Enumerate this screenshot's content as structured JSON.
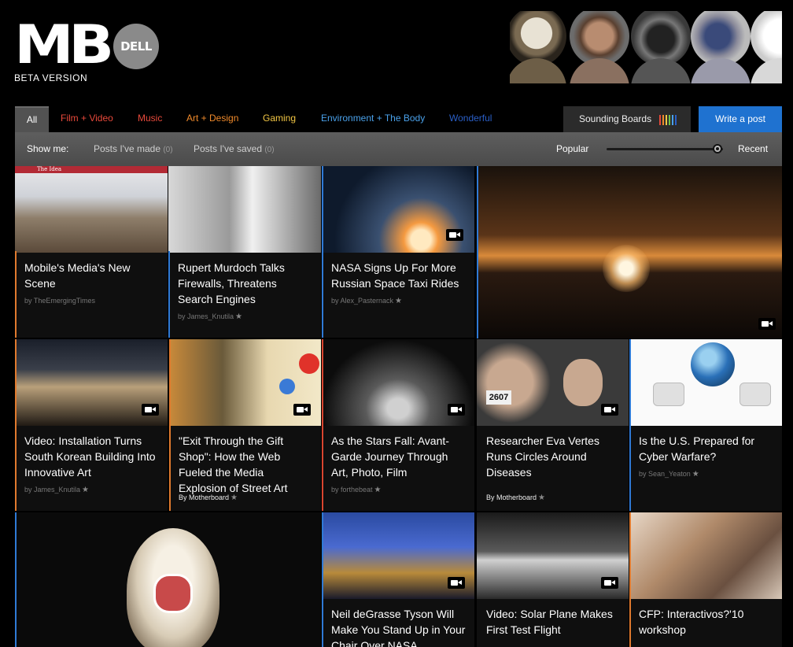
{
  "header": {
    "logo_text": "MB",
    "partner_logo": "DELL",
    "beta_label": "BETA VERSION"
  },
  "nav": {
    "tabs": [
      {
        "label": "All",
        "color": "#ffffff"
      },
      {
        "label": "Film + Video",
        "color": "#e8493b"
      },
      {
        "label": "Music",
        "color": "#e8493b"
      },
      {
        "label": "Art + Design",
        "color": "#f08a2b"
      },
      {
        "label": "Gaming",
        "color": "#f2c644"
      },
      {
        "label": "Environment + The Body",
        "color": "#4aa1ea"
      },
      {
        "label": "Wonderful",
        "color": "#2a5fc7"
      }
    ],
    "sounding_boards_label": "Sounding Boards",
    "sounding_bar_colors": [
      "#e8493b",
      "#f08a2b",
      "#f2c644",
      "#6cc24a",
      "#4aa1ea",
      "#2a5fc7"
    ],
    "write_post_label": "Write a post"
  },
  "filter": {
    "show_me_label": "Show me:",
    "posts_made_label": "Posts I've made",
    "posts_made_count": "(0)",
    "posts_saved_label": "Posts I've saved",
    "posts_saved_count": "(0)",
    "popular_label": "Popular",
    "recent_label": "Recent",
    "slider_value": 1.0
  },
  "cards": [
    {
      "title": "Mobile's Media's New Scene",
      "byline": "by TheEmergingTimes",
      "star": "",
      "video": false
    },
    {
      "title": "Rupert Murdoch Talks Firewalls, Threatens Search Engines",
      "byline": "by James_Knutila",
      "star": "★",
      "video": false
    },
    {
      "title": "NASA Signs Up For More Russian Space Taxi Rides",
      "byline": "by Alex_Pasternack",
      "star": "★",
      "video": true
    },
    {
      "title": "Video: Installation Turns South Korean Building Into Innovative Art",
      "byline": "by James_Knutila",
      "star": "★",
      "video": true
    },
    {
      "title": "\"Exit Through the Gift Shop\": How the Web Fueled the Media Explosion of Street Art",
      "byline": "By Motherboard",
      "star": "★",
      "video": true
    },
    {
      "title": "As the Stars Fall: Avant-Garde Journey Through Art, Photo, Film",
      "byline": "by forthebeat",
      "star": "★",
      "video": true
    },
    {
      "title": "Researcher Eva Vertes Runs Circles Around Diseases",
      "byline": "By Motherboard",
      "star": "★",
      "video": true
    },
    {
      "title": "Is the U.S. Prepared for Cyber Warfare?",
      "byline": "by Sean_Yeaton",
      "star": "★",
      "video": false
    },
    {
      "title": "Neil deGrasse Tyson Will Make You Stand Up in Your Chair Over NASA",
      "byline": "",
      "star": "",
      "video": true
    },
    {
      "title": "Video: Solar Plane Makes First Test Flight",
      "byline": "",
      "star": "",
      "video": true
    },
    {
      "title": "CFP: Interactivos?'10 workshop",
      "byline": "",
      "star": "",
      "video": false
    }
  ],
  "image_labels": {
    "newspaper_masthead": "The Idea",
    "bib_number": "2607"
  },
  "colors": {
    "accent_blue": "#1f72d0",
    "edge_orange": "#e07a2e",
    "edge_blue": "#2f7ad6",
    "edge_red": "#d9452f"
  }
}
